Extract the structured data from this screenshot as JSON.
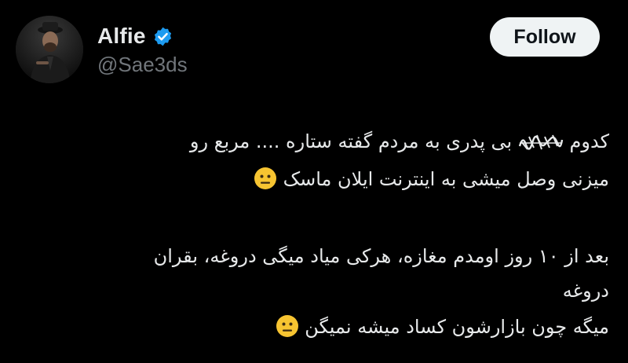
{
  "user": {
    "display_name": "Alfie",
    "handle": "@Sae3ds",
    "verified_icon": "verified-badge-icon",
    "verified_color": "#1d9bf0"
  },
  "follow_button": {
    "label": "Follow"
  },
  "tweet": {
    "line1_start": "کدوم",
    "line1_rest": "بی پدری به مردم گفته ستاره .... مربع رو",
    "line2": "میزنی وصل میشی به اینترنت ایلان ماسک",
    "line3": "بعد از ۱۰ روز اومدم مغازه، هرکی میاد میگی دروغه، بقران",
    "line4": "دروغه",
    "line5": "میگه چون بازارشون کساد میشه نمیگن",
    "emoji": "neutral-face-emoji"
  },
  "colors": {
    "background": "#000000",
    "text": "#e7e9ea",
    "secondary_text": "#71767b",
    "button_bg": "#eff3f4",
    "button_text": "#0f1419"
  }
}
